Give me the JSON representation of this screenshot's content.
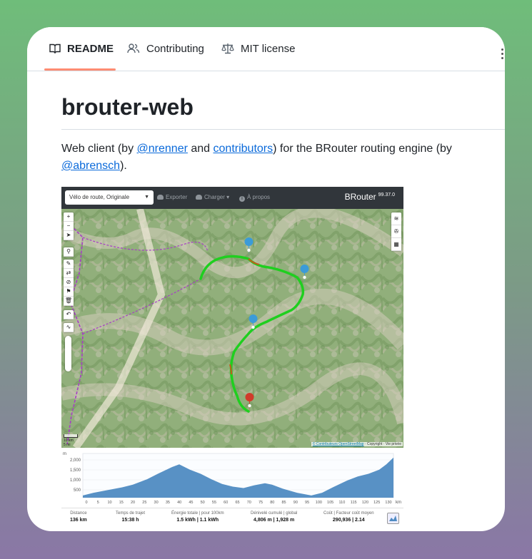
{
  "tabs": [
    {
      "label": "README",
      "icon": "book-icon",
      "active": true
    },
    {
      "label": "Contributing",
      "icon": "people-icon"
    },
    {
      "label": "MIT license",
      "icon": "scale-icon"
    }
  ],
  "readme": {
    "title": "brouter-web",
    "desc_part1": "Web client (by ",
    "link_author": "@nrenner",
    "desc_part2": " and ",
    "link_contributors": "contributors",
    "desc_part3": ") for the BRouter routing engine (by ",
    "link_engine_author": "@abrensch",
    "desc_part4": ")."
  },
  "app": {
    "profile": "Vélo de route, Originale",
    "toolbar": [
      "Exporter",
      "Charger",
      "À propos"
    ],
    "brand": "BRouter",
    "version": "99.37.0",
    "scale_km": "10 km",
    "scale_mi": "5 mi",
    "attribution_prefix": "© Contributeurs OpenStreetMap",
    "attribution_suffix": "· Copyright · Vie privée",
    "profile_unit_y": "m",
    "profile_unit_x": "km",
    "profile_yticks": [
      "2,000",
      "1,500",
      "1,000",
      "500"
    ],
    "profile_xticks": [
      "0",
      "5",
      "10",
      "15",
      "20",
      "25",
      "30",
      "35",
      "40",
      "45",
      "50",
      "55",
      "60",
      "65",
      "70",
      "75",
      "80",
      "85",
      "90",
      "95",
      "100",
      "105",
      "110",
      "115",
      "120",
      "125",
      "130"
    ],
    "stats": [
      {
        "label": "Distance",
        "value": "136 km"
      },
      {
        "label": "Temps de trajet",
        "value": "15:38 h"
      },
      {
        "label": "Énergie totale | pour 100km",
        "value": "1.5 kWh | 1.1 kWh"
      },
      {
        "label": "Dénivelé cumulé | global",
        "value": "4,806 m | 1,928 m"
      },
      {
        "label": "Coût | Facteur coût moyen",
        "value": "290,936 | 2.14"
      }
    ]
  },
  "colors": {
    "accent_underline": "#fd8c73",
    "link": "#0969da",
    "route": "#1fcf1f",
    "marker_waypoint": "#3b9bd8",
    "marker_end": "#d03b2b",
    "elevation_fill": "#4f8bc2",
    "topbar": "#31363b"
  }
}
